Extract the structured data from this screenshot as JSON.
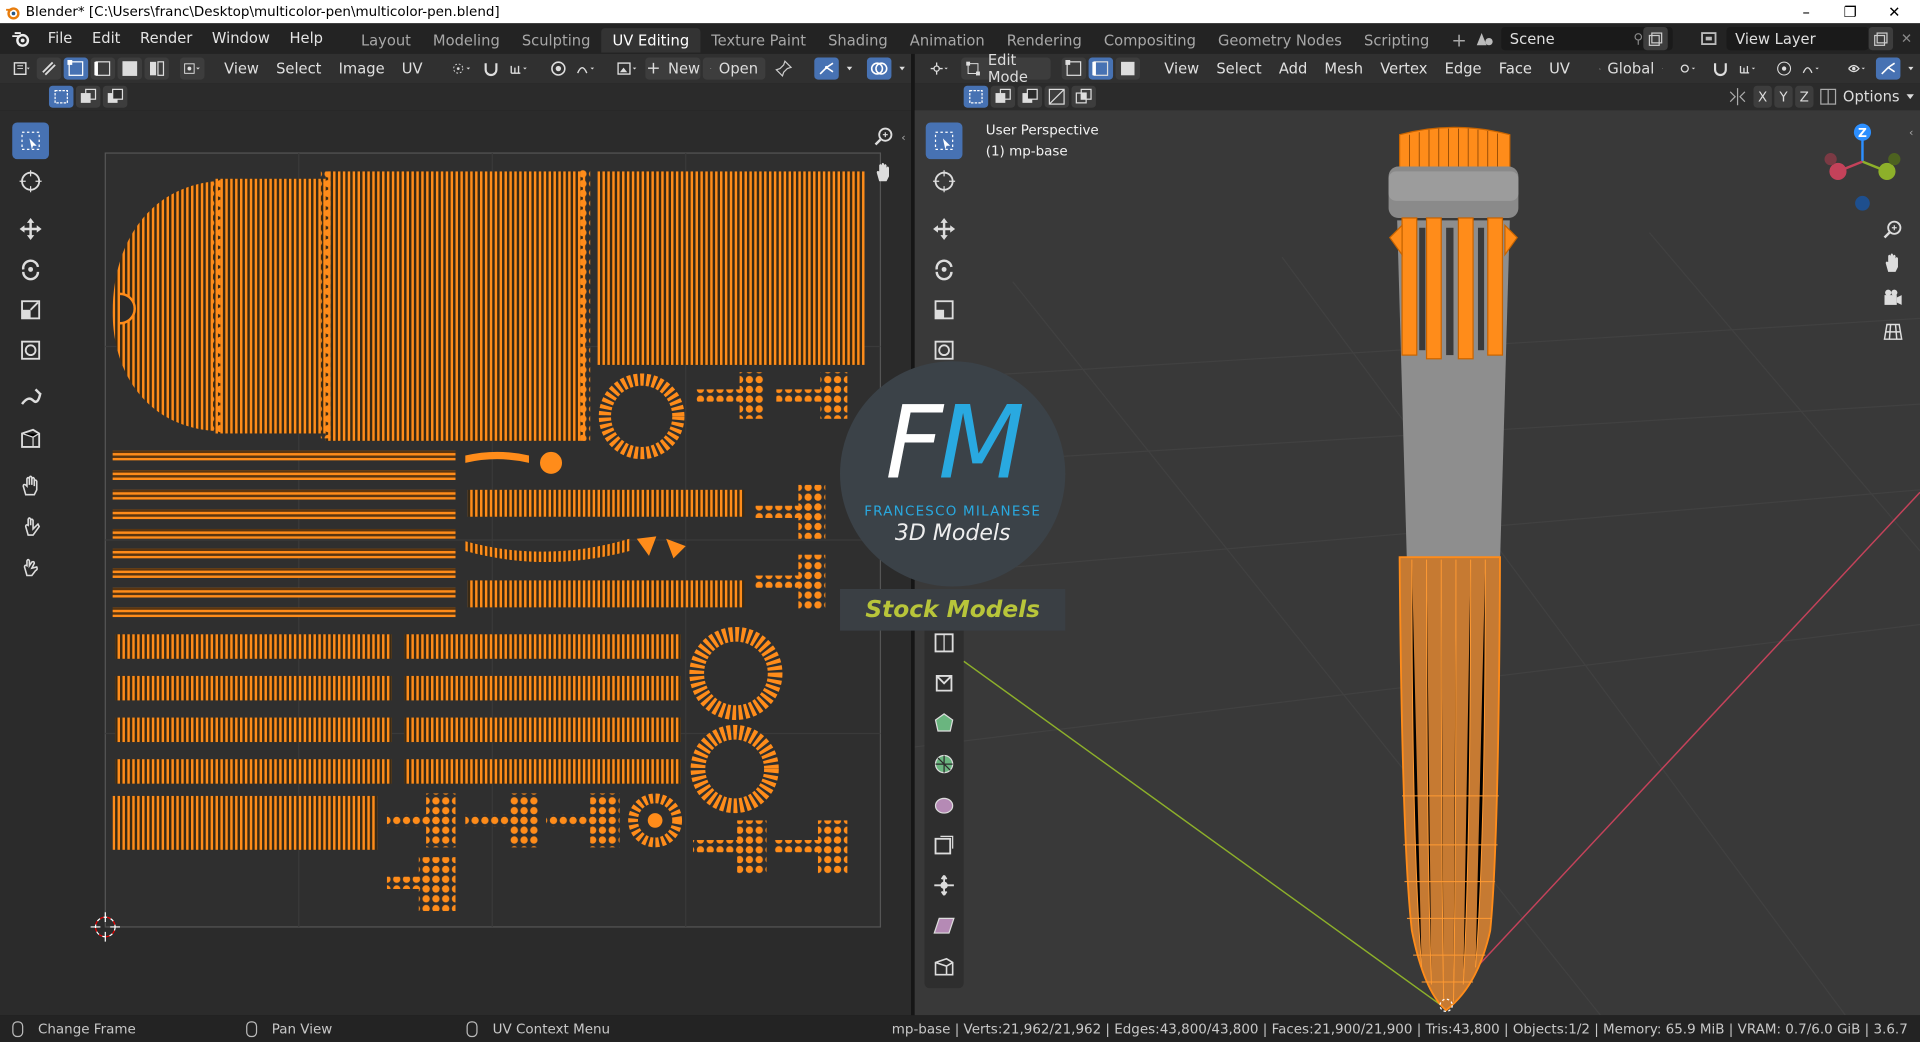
{
  "window": {
    "title": "Blender* [C:\\Users\\franc\\Desktop\\multicolor-pen\\multicolor-pen.blend]",
    "minimize": "–",
    "maximize": "❐",
    "close": "✕"
  },
  "menu": [
    "File",
    "Edit",
    "Render",
    "Window",
    "Help"
  ],
  "workspaces": {
    "tabs": [
      "Layout",
      "Modeling",
      "Sculpting",
      "UV Editing",
      "Texture Paint",
      "Shading",
      "Animation",
      "Rendering",
      "Compositing",
      "Geometry Nodes",
      "Scripting"
    ],
    "active": "UV Editing",
    "add": "+"
  },
  "scene": {
    "name": "Scene",
    "view_layer": "View Layer"
  },
  "uv_header": {
    "menus": [
      "View",
      "Select",
      "Image",
      "UV"
    ],
    "new_label": "New",
    "open_label": "Open"
  },
  "vp_header": {
    "mode": "Edit Mode",
    "menus": [
      "View",
      "Select",
      "Add",
      "Mesh",
      "Vertex",
      "Edge",
      "Face",
      "UV"
    ],
    "orientation": "Global",
    "axes": [
      "X",
      "Y",
      "Z"
    ],
    "options": "Options"
  },
  "viewport": {
    "perspective": "User Perspective",
    "object": "(1) mp-base"
  },
  "logo": {
    "initials": "FM",
    "name": "FRANCESCO MILANESE",
    "tagline": "3D Models",
    "banner": "Stock Models"
  },
  "colors": {
    "accent": "#4772b3",
    "uv_orange": "#ff8c1a",
    "logo_blue": "#29a9e0"
  },
  "statusbar": {
    "left": [
      "Change Frame",
      "Pan View",
      "UV Context Menu"
    ],
    "stats": "mp-base | Verts:21,962/21,962 | Edges:43,800/43,800 | Faces:21,900/21,900 | Tris:43,800 | Objects:1/2 | Memory: 65.9 MiB | VRAM: 0.7/6.0 GiB | 3.6.7"
  }
}
